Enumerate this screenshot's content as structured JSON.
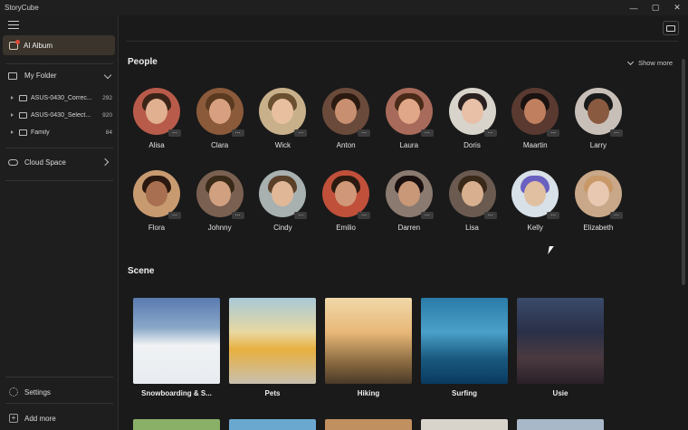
{
  "window": {
    "title": "StoryCube",
    "controls": [
      "—",
      "▢",
      "✕"
    ]
  },
  "sidebar": {
    "ai_album_label": "AI Album",
    "my_folder_label": "My Folder",
    "folders": [
      {
        "name": "ASUS-0430_Correc...",
        "count": "292"
      },
      {
        "name": "ASUS-0430_Select...",
        "count": "920"
      },
      {
        "name": "Family",
        "count": "84"
      }
    ],
    "cloud_label": "Cloud Space",
    "settings_label": "Settings",
    "add_more_label": "Add more"
  },
  "people": {
    "title": "People",
    "show_more": "Show more",
    "row1": [
      "Alisa",
      "Clara",
      "Wick",
      "Anton",
      "Laura",
      "Doris",
      "Maartin",
      "Larry"
    ],
    "row2": [
      "Flora",
      "Johnny",
      "Cindy",
      "Emilio",
      "Darren",
      "Lisa",
      "Kelly",
      "Elizabeth"
    ]
  },
  "scene": {
    "title": "Scene",
    "items": [
      "Snowboarding & S...",
      "Pets",
      "Hiking",
      "Surfing",
      "Usie"
    ]
  },
  "colors": {
    "accent_selected": "#3a342c",
    "notification_dot": "#e24a3b",
    "background": "#1a1a1a"
  }
}
